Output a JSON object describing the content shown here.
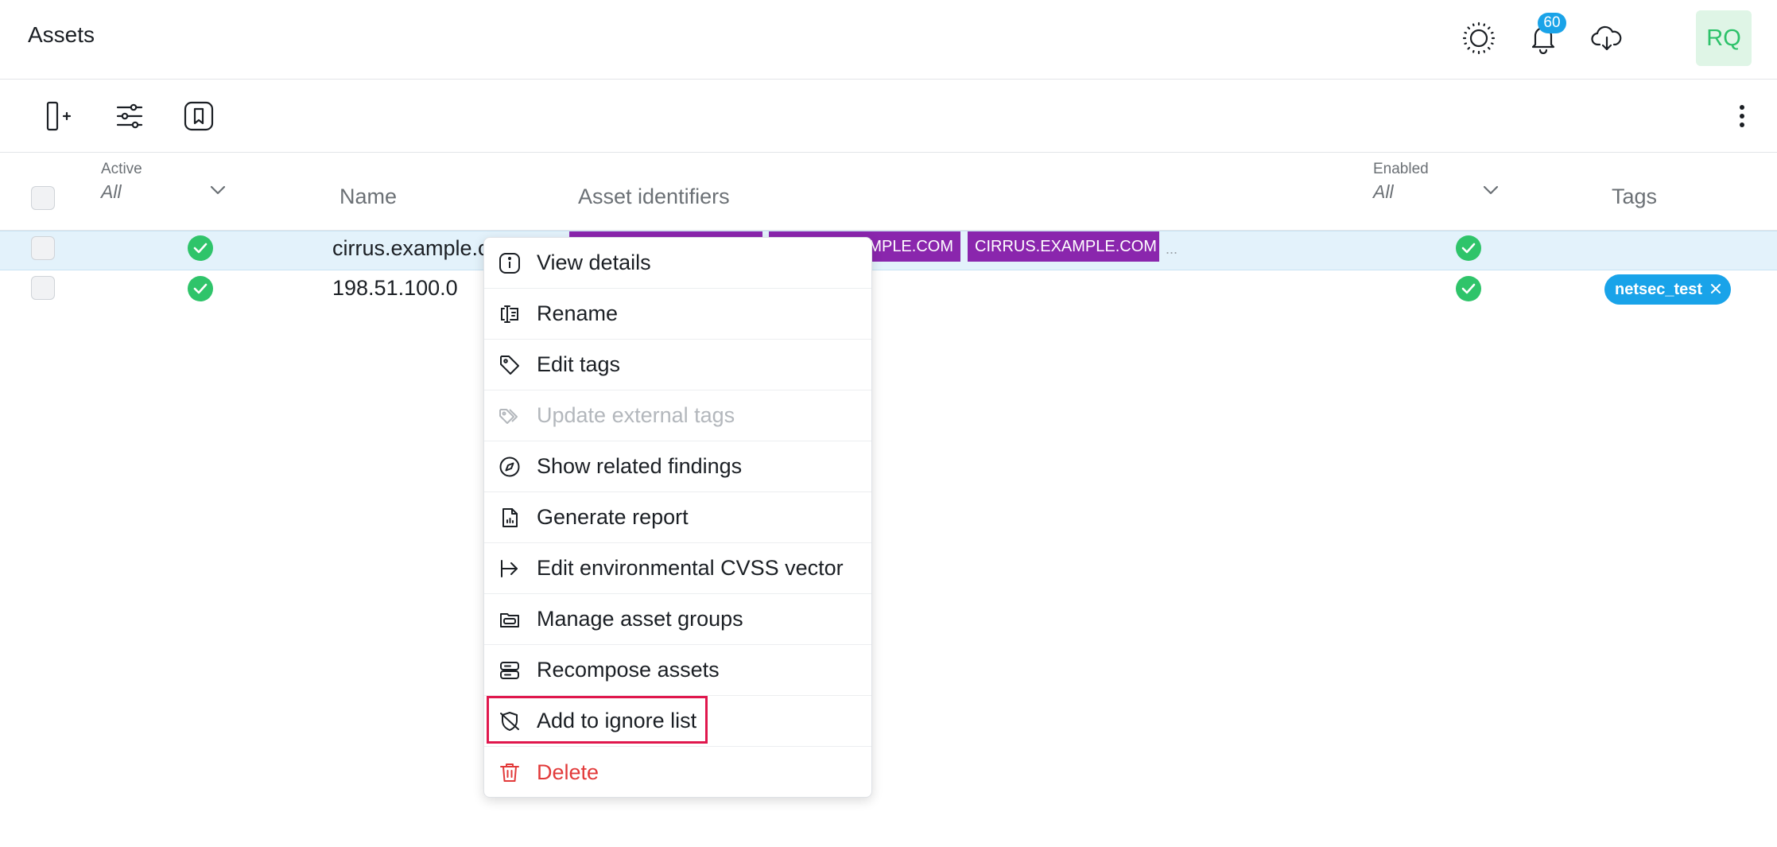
{
  "header": {
    "title": "Assets",
    "notification_count": "60",
    "avatar_initials": "RQ",
    "icons": [
      "sun-icon",
      "bell-icon",
      "cloud-download-icon"
    ]
  },
  "toolbar": {
    "icons": [
      "add-column-icon",
      "filters-icon",
      "bookmark-icon",
      "more-vertical-icon"
    ]
  },
  "table": {
    "columns": {
      "active_label": "Active",
      "active_value": "All",
      "name": "Name",
      "identifiers": "Asset identifiers",
      "enabled_label": "Enabled",
      "enabled_value": "All",
      "tags": "Tags"
    },
    "rows": [
      {
        "name": "cirrus.example.c",
        "identifiers": [
          "",
          "MPLE.COM",
          "CIRRUS.EXAMPLE.COM"
        ],
        "more": "...",
        "tags": []
      },
      {
        "name": "198.51.100.0",
        "identifiers": [],
        "tags": [
          "netsec_test"
        ]
      }
    ]
  },
  "context_menu": {
    "items": [
      {
        "label": "View details",
        "icon": "info-icon"
      },
      {
        "label": "Rename",
        "icon": "rename-icon"
      },
      {
        "label": "Edit tags",
        "icon": "tag-icon"
      },
      {
        "label": "Update external tags",
        "icon": "tags-icon",
        "disabled": true
      },
      {
        "label": "Show related findings",
        "icon": "compass-icon"
      },
      {
        "label": "Generate report",
        "icon": "report-file-icon"
      },
      {
        "label": "Edit environmental CVSS vector",
        "icon": "arrow-right-icon"
      },
      {
        "label": "Manage asset groups",
        "icon": "folder-icon"
      },
      {
        "label": "Recompose assets",
        "icon": "server-icon"
      },
      {
        "label": "Add to ignore list",
        "icon": "shield-off-icon"
      },
      {
        "label": "Delete",
        "icon": "trash-icon",
        "danger": true
      }
    ]
  },
  "colors": {
    "accent_blue": "#19a3e9",
    "identifier_purple": "#8a26ad",
    "success_green": "#2fc46a",
    "danger_red": "#e23a3a",
    "highlight_red": "#e0174d",
    "selected_row": "#e3f2fb"
  }
}
